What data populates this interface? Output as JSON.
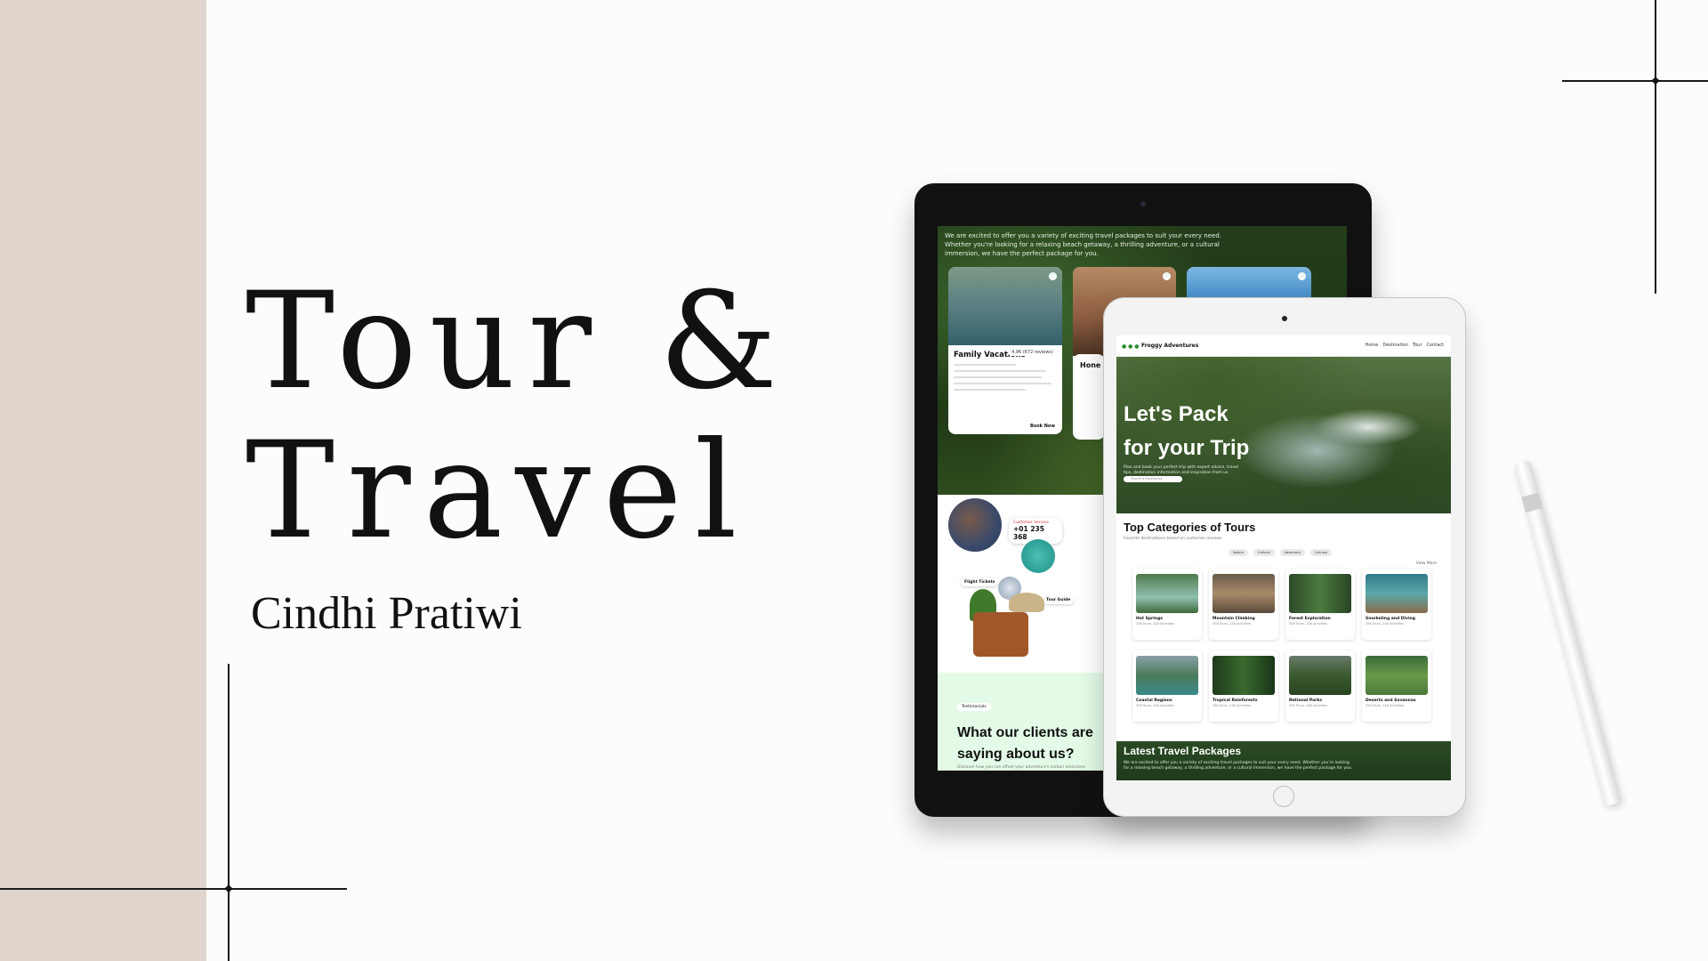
{
  "slide": {
    "title_line1": "Tour &",
    "title_line2": "Travel",
    "author": "Cindhi Pratiwi"
  },
  "colors": {
    "side_band": "#e0d5cc",
    "background": "#fdfcfb",
    "text": "#111111",
    "clients_bg": "#e3fbe6"
  },
  "back_tablet": {
    "intro_text": "We are excited to offer you a variety of exciting travel packages to suit your every need. Whether you're looking for a relaxing beach getaway, a thrilling adventure, or a cultural immersion, we have the perfect package for you.",
    "card1": {
      "title": "Family Vacations",
      "rating": "4.96 (672 reviews)",
      "book": "Book Now"
    },
    "card2_title": "Hone",
    "contact": {
      "label": "Customer Service",
      "number": "+01 235 368"
    },
    "flight_label": "Flight Tickets",
    "guide_label": "Tour Guide",
    "testimonial_tag": "Testimonials",
    "clients_title": "What our clients are saying about us?",
    "clients_sub": "Discover how you can offset your adventure's carbon emissions"
  },
  "front_tablet": {
    "brand": "Froggy Adventures",
    "nav": [
      "Home",
      "Destination",
      "Tour",
      "Contact"
    ],
    "hero_title_line1": "Let's Pack",
    "hero_title_line2": "for your Trip",
    "hero_sub": "Plan and book your perfect trip with expert advice, travel tips, destination information and inspiration from us.",
    "search_placeholder": "Search a destination",
    "categories_title": "Top Categories of Tours",
    "categories_sub": "Favorite destinations based on customer reviews",
    "filters": [
      "Nature",
      "Cultural",
      "Adventure",
      "Culinary"
    ],
    "view_more": "View More",
    "categories": [
      {
        "name": "Hot Springs",
        "count": "356 Tours, 248 Activities"
      },
      {
        "name": "Mountain Climbing",
        "count": "356 Tours, 248 Activities"
      },
      {
        "name": "Forest Exploration",
        "count": "356 Tours, 248 Activities"
      },
      {
        "name": "Snorkeling and Diving",
        "count": "356 Tours, 248 Activities"
      },
      {
        "name": "Coastal Regions",
        "count": "356 Tours, 248 Activities"
      },
      {
        "name": "Tropical Rainforests",
        "count": "356 Tours, 248 Activities"
      },
      {
        "name": "National Parks",
        "count": "356 Tours, 248 Activities"
      },
      {
        "name": "Deserts and Savannas",
        "count": "356 Tours, 248 Activities"
      }
    ],
    "latest_title": "Latest Travel Packages",
    "latest_sub": "We are excited to offer you a variety of exciting travel packages to suit your every need. Whether you're looking for a relaxing beach getaway, a thrilling adventure, or a cultural immersion, we have the perfect package for you."
  }
}
